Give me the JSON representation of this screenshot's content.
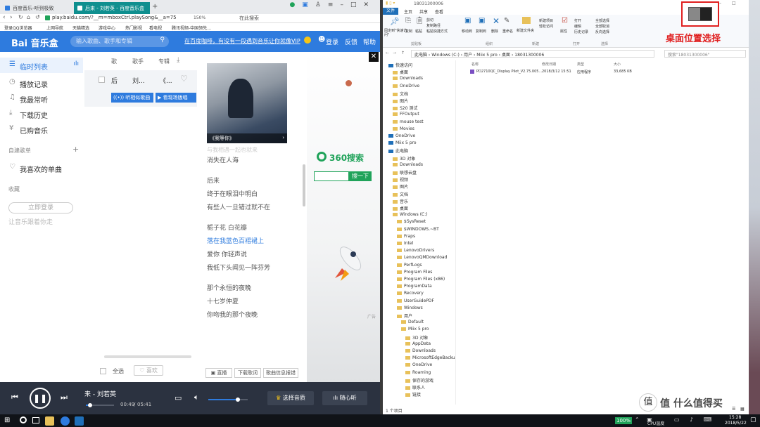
{
  "browser": {
    "tabs": [
      {
        "title": "百度音乐-听到极致"
      },
      {
        "title": "后来 - 刘若英 - 百度音乐盒"
      }
    ],
    "url": "play.baidu.com/?__m=mboxCtrl.playSong&__a=75",
    "zoom": "150%",
    "search_engine_label": "在此搜索",
    "bookmarks": [
      "登录QQ浏览器",
      "上网导航",
      "天猫精选",
      "游戏中心",
      "热门影视",
      "看电视",
      "腾讯视频-中国领先..."
    ]
  },
  "music": {
    "logo_text": "Bai 音乐盒",
    "search_placeholder": "输入歌曲、歌手和专辑",
    "promo_text": "在百度咖啡，有没有一段遇到音乐让你就像VIP",
    "header_links": [
      "登录",
      "反馈",
      "帮助"
    ],
    "sidebar": {
      "items": [
        {
          "label": "临时列表"
        },
        {
          "label": "播放记录"
        },
        {
          "label": "我最常听"
        },
        {
          "label": "下载历史"
        },
        {
          "label": "已购音乐"
        }
      ],
      "section_playlists": "自建歌单",
      "favorites": "我喜欢的单曲",
      "section_collect": "收藏",
      "login_button": "立即登录",
      "collect_hint": "让音乐跟着你走"
    },
    "list": {
      "col_song": "歌",
      "col_artist": "歌手",
      "col_album": "专辑",
      "row": {
        "song": "后",
        "artist": "刘...",
        "album": "《..."
      },
      "btn_listen": "听相似歌曲",
      "btn_video": "看现场版唱",
      "select_all": "全选",
      "like": "喜欢"
    },
    "album_caption": "《我等你》",
    "lyrics": [
      "消失在人海",
      "后来",
      "终于在眼泪中明白",
      "有些人一旦错过就不在",
      "栀子花 白花瓣",
      "落在我蓝色百褶裙上",
      "爱你 你轻声说",
      "我低下头闻见一阵芬芳",
      "那个永恒的夜晚",
      "十七岁仲夏",
      "你吻我的那个夜晚"
    ],
    "active_lyric_index": 5,
    "lyric_buttons": [
      "直播",
      "下载歌词",
      "歌曲信息报错"
    ],
    "ad": {
      "brand": "360搜索",
      "button": "搜一下"
    },
    "player": {
      "now_playing": "来 - 刘若英",
      "elapsed": "00:49",
      "total": "05:41",
      "progress_fraction": 0.14,
      "volume_fraction": 0.75,
      "quality_button": "选择音质",
      "radio_button": "随心听"
    }
  },
  "explorer": {
    "ribbon_tabs": [
      "文件",
      "主页",
      "共享",
      "查看"
    ],
    "ribbon_groups": [
      "剪贴板",
      "组织",
      "新建",
      "打开",
      "选择"
    ],
    "ribbon_items": {
      "pin": "固定到\"快速访问\"",
      "copy": "复制",
      "paste": "粘贴",
      "cut": "剪切",
      "copy_path": "复制路径",
      "paste_shortcut": "粘贴快捷方式",
      "move_to": "移动到",
      "copy_to": "复制到",
      "delete": "删除",
      "rename": "重命名",
      "new_folder": "新建文件夹",
      "new_item": "新建项目",
      "easy_access": "轻松访问",
      "properties": "属性",
      "open": "打开",
      "edit": "编辑",
      "history": "历史记录",
      "select_all": "全部选择",
      "select_none": "全部取消",
      "invert": "反向选择"
    },
    "breadcrumb": [
      "此电脑",
      "Windows (C:)",
      "用户",
      "Miix 5 pro",
      "桌面",
      "18031300006"
    ],
    "search_placeholder": "搜索\"18031300006\"",
    "window_title": "18031300006",
    "columns": [
      "名称",
      "修改日期",
      "类型",
      "大小"
    ],
    "files": [
      {
        "name": "PD2710QC_Display Pilot_V2.75.005...",
        "date": "2018/3/12 15:51",
        "type": "应用程序",
        "size": "33,685 KB"
      }
    ],
    "tree": [
      "快速访问",
      "桌面",
      "Downloads",
      "OneDrive",
      "文档",
      "图片",
      "S20 测试",
      "FFOutput",
      "mouse test",
      "Movies",
      "OneDrive",
      "Miix 5 pro",
      "此电脑",
      "3D 对象",
      "Downloads",
      "联想云盘",
      "视频",
      "图片",
      "文档",
      "音乐",
      "桌面",
      "Windows (C:)",
      "$SysReset",
      "$WINDOWS.~BT",
      "Fraps",
      "Intel",
      "LenovoDrivers",
      "LenovoQMDownload",
      "PerfLogs",
      "Program Files",
      "Program Files (x86)",
      "ProgramData",
      "Recovery",
      "UserGuidePDF",
      "Windows",
      "用户",
      "Default",
      "Miix 5 pro",
      "3D 对象",
      "AppData",
      "Downloads",
      "MicrosoftEdgeBackups",
      "OneDrive",
      "Roaming",
      "保存的游戏",
      "联系人",
      "链接"
    ],
    "status": "1 个项目",
    "annotation": "桌面位置选择"
  },
  "taskbar": {
    "battery": "100%",
    "ime": "CPU温度",
    "time": "15:28",
    "date": "2018/5/22",
    "watermark": "值 什么值得买"
  },
  "colors": {
    "baidu_blue": "#2e7bde",
    "player_bg": "#2b3240",
    "accent_orange": "#f39c12",
    "ad_green": "#20a35a",
    "explorer_blue": "#1f6fb8",
    "annotation_red": "#e02020"
  }
}
